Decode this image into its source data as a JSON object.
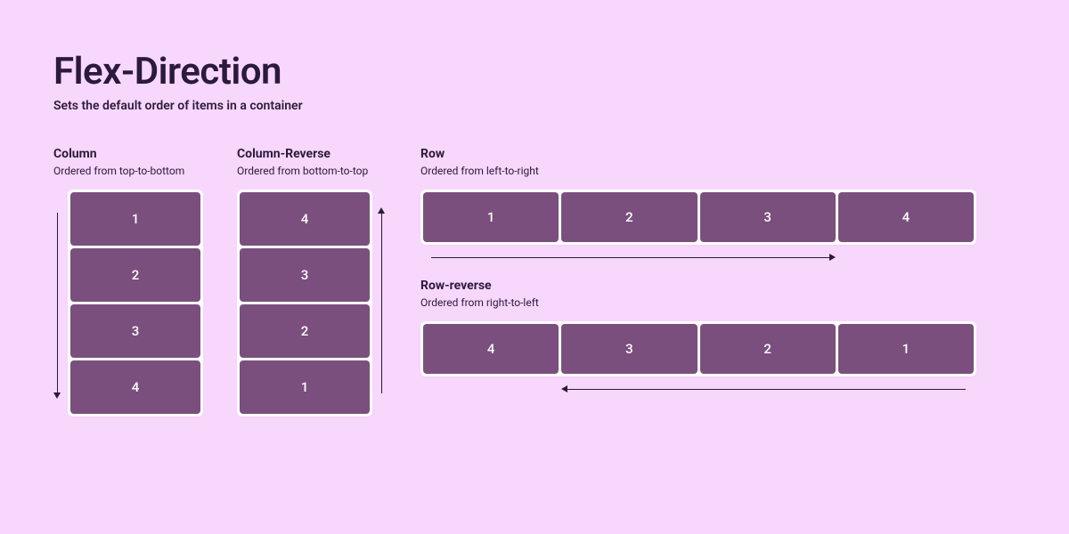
{
  "title": "Flex-Direction",
  "subtitle": "Sets the default order of items in a container",
  "sections": {
    "column": {
      "title": "Column",
      "desc": "Ordered from top-to-bottom",
      "items": [
        "1",
        "2",
        "3",
        "4"
      ]
    },
    "column_reverse": {
      "title": "Column-Reverse",
      "desc": "Ordered from bottom-to-top",
      "items": [
        "4",
        "3",
        "2",
        "1"
      ]
    },
    "row": {
      "title": "Row",
      "desc": "Ordered from left-to-right",
      "items": [
        "1",
        "2",
        "3",
        "4"
      ]
    },
    "row_reverse": {
      "title": "Row-reverse",
      "desc": "Ordered from right-to-left",
      "items": [
        "4",
        "3",
        "2",
        "1"
      ]
    }
  },
  "colors": {
    "bg": "#f8d7fc",
    "item_bg": "#7a4f7d",
    "text": "#2b1a3d"
  }
}
